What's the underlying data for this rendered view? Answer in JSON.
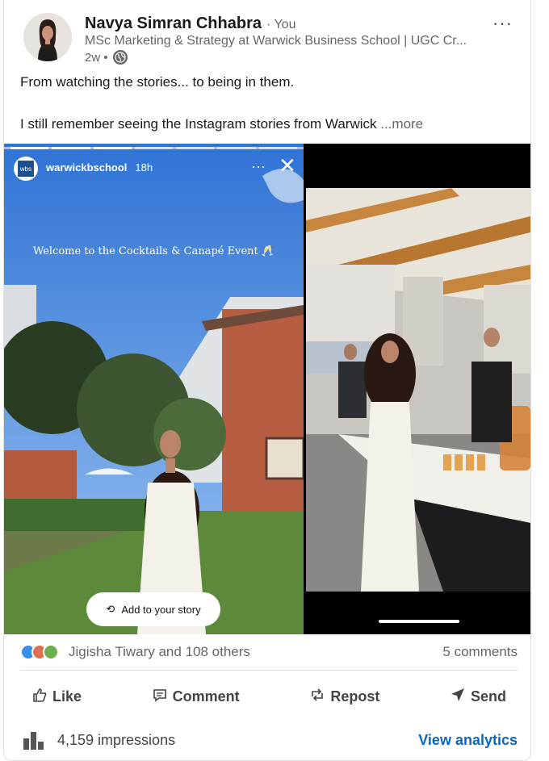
{
  "author": {
    "name": "Navya Simran Chhabra",
    "you_label": "· You",
    "headline": "MSc Marketing & Strategy at Warwick Business School | UGC Cr...",
    "time": "2w •"
  },
  "post": {
    "line1": "From watching the stories... to being in them.",
    "line2": "I still remember seeing the Instagram stories from Warwick",
    "more": "...more"
  },
  "story": {
    "account": "warwickbschool",
    "time": "18h",
    "caption": "Welcome to the Cocktails & Canapé Event 🥂",
    "add_button": "Add to your story",
    "logo_text": "wbs"
  },
  "stats": {
    "reactions_text": "Jigisha Tiwary and 108 others",
    "comments": "5 comments"
  },
  "actions": {
    "like": "Like",
    "comment": "Comment",
    "repost": "Repost",
    "send": "Send"
  },
  "footer": {
    "impressions": "4,159 impressions",
    "analytics": "View analytics"
  },
  "colors": {
    "link": "#0a66c2",
    "secondary_text": "#666666",
    "sky": "#3d86e0"
  }
}
